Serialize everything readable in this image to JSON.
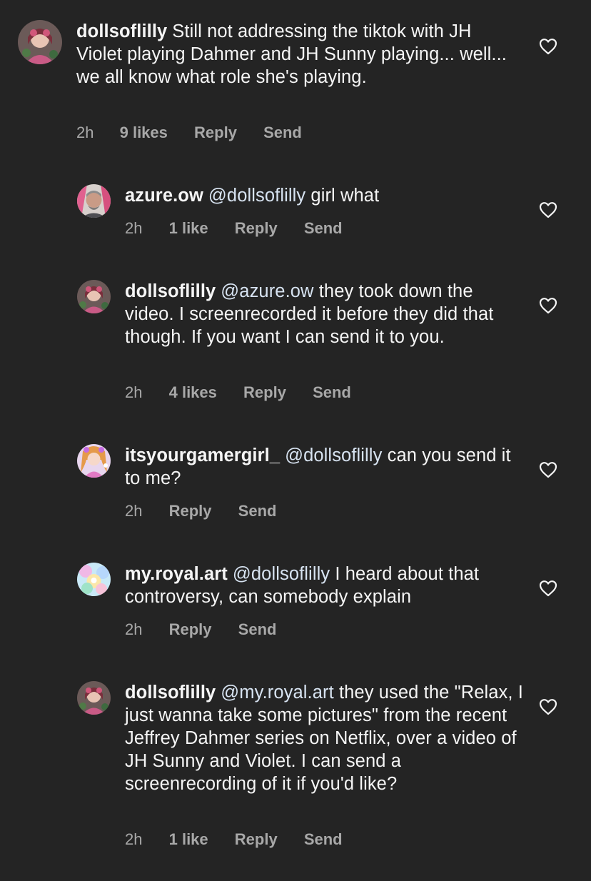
{
  "comments": [
    {
      "username": "dollsoflilly",
      "mention": "",
      "text": "Still not addressing the tiktok with JH Violet playing Dahmer and JH Sunny playing... well... we all know what role she's playing.",
      "time": "2h",
      "likes": "9 likes",
      "reply": "Reply",
      "send": "Send"
    },
    {
      "username": "azure.ow",
      "mention": "@dollsoflilly",
      "text": "girl what",
      "time": "2h",
      "likes": "1 like",
      "reply": "Reply",
      "send": "Send"
    },
    {
      "username": "dollsoflilly",
      "mention": "@azure.ow",
      "text": "they took down the video. I screenrecorded it before they did that though. If you want I can send it to you.",
      "time": "2h",
      "likes": "4 likes",
      "reply": "Reply",
      "send": "Send"
    },
    {
      "username": "itsyourgamergirl_",
      "mention": "@dollsoflilly",
      "text": "can you send it to me?",
      "time": "2h",
      "likes": "",
      "reply": "Reply",
      "send": "Send"
    },
    {
      "username": "my.royal.art",
      "mention": "@dollsoflilly",
      "text": "I heard about that controversy, can somebody explain",
      "time": "2h",
      "likes": "",
      "reply": "Reply",
      "send": "Send"
    },
    {
      "username": "dollsoflilly",
      "mention": "@my.royal.art",
      "text": "they used the \"Relax, I just wanna take some pictures\" from the recent Jeffrey Dahmer series on Netflix, over a video of JH Sunny and Violet. I can send a screenrecording of it if you'd like?",
      "time": "2h",
      "likes": "1 like",
      "reply": "Reply",
      "send": "Send"
    }
  ],
  "icons": {
    "like": "heart-outline-icon"
  },
  "colors": {
    "background": "#242424",
    "text": "#f5f5f5",
    "mention": "#d7e3f1",
    "meta": "#a8a8a8"
  }
}
